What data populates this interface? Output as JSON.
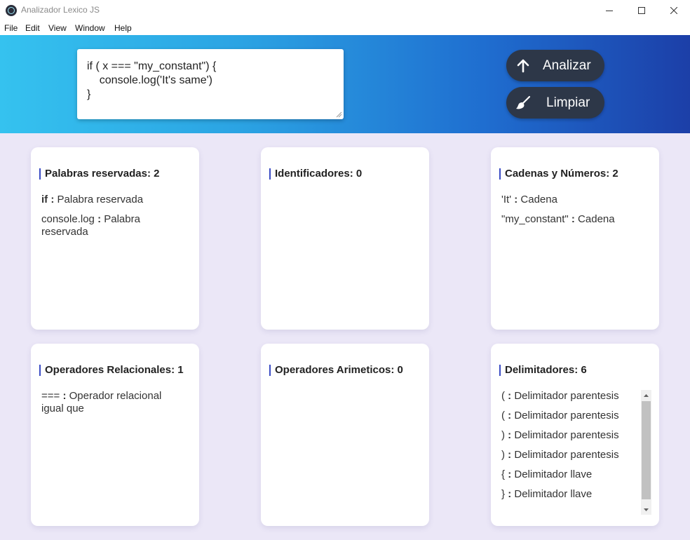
{
  "window": {
    "title": "Analizador Lexico JS",
    "controls": [
      "minimize-icon",
      "maximize-icon",
      "close-icon"
    ]
  },
  "menu": [
    "File",
    "Edit",
    "View",
    "Window",
    "Help"
  ],
  "editor": {
    "value": "if ( x === \"my_constant\") {\n    console.log('It's same')\n}"
  },
  "buttons": {
    "analyze": {
      "label": "Analizar",
      "icon": "arrow-up-icon"
    },
    "clear": {
      "label": "Limpiar",
      "icon": "broom-icon"
    }
  },
  "colors": {
    "header_gradient": [
      "#35c2ef",
      "#1c3fa8"
    ],
    "button_bg": "#2d3748",
    "card_accent": "#3a4bc4",
    "page_bg": "#ebe7f7"
  },
  "cards": [
    {
      "title": "Palabras reservadas: 2",
      "items": [
        {
          "token": "if",
          "desc": "Palabra reservada"
        },
        {
          "token": "console.log",
          "desc": "Palabra reservada"
        }
      ]
    },
    {
      "title": "Identificadores: 0",
      "items": []
    },
    {
      "title": "Cadenas y Números: 2",
      "items": [
        {
          "token": "'It'",
          "desc": "Cadena"
        },
        {
          "token": "\"my_constant\"",
          "desc": "Cadena"
        }
      ]
    },
    {
      "title": "Operadores Relacionales: 1",
      "items": [
        {
          "token": "===",
          "desc": "Operador relacional igual que"
        }
      ]
    },
    {
      "title": "Operadores Arimeticos: 0",
      "items": []
    },
    {
      "title": "Delimitadores: 6",
      "items": [
        {
          "token": "(",
          "desc": "Delimitador parentesis"
        },
        {
          "token": "(",
          "desc": "Delimitador parentesis"
        },
        {
          "token": ")",
          "desc": "Delimitador parentesis"
        },
        {
          "token": ")",
          "desc": "Delimitador parentesis"
        },
        {
          "token": "{",
          "desc": "Delimitador llave"
        },
        {
          "token": "}",
          "desc": "Delimitador llave"
        }
      ]
    }
  ]
}
